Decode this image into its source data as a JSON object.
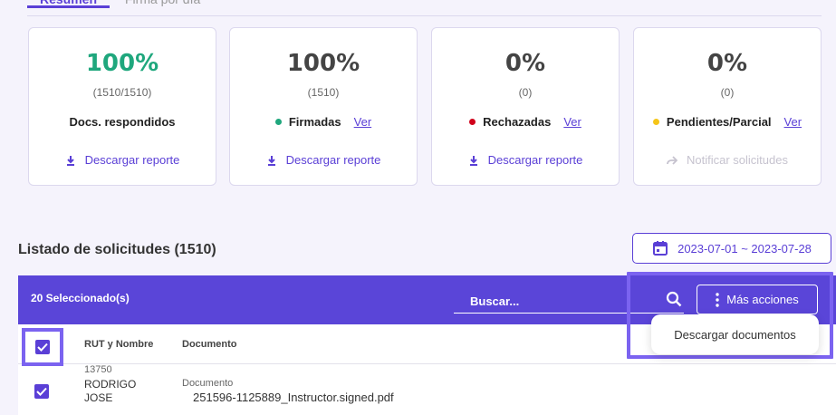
{
  "tabs": [
    {
      "label": "Resumen"
    },
    {
      "label": "Firma por día"
    }
  ],
  "cards": [
    {
      "percent": "100%",
      "count": "(1510/1510)",
      "label": "Docs. respondidos",
      "action": "Descargar reporte",
      "color": "#1fa77d"
    },
    {
      "percent": "100%",
      "count": "(1510)",
      "label": "Firmadas",
      "link": "Ver",
      "dot": "#1fa77d",
      "action": "Descargar reporte"
    },
    {
      "percent": "0%",
      "count": "(0)",
      "label": "Rechazadas",
      "link": "Ver",
      "dot": "#d0021b",
      "action": "Descargar reporte"
    },
    {
      "percent": "0%",
      "count": "(0)",
      "label": "Pendientes/Parcial",
      "link": "Ver",
      "dot": "#f5c518",
      "action": "Notificar solicitudes"
    }
  ],
  "list": {
    "title": "Listado de solicitudes (1510)",
    "date_range": "2023-07-01 ~ 2023-07-28"
  },
  "toolbar": {
    "selected": "20 Seleccionado(s)",
    "search_placeholder": "Buscar...",
    "more_actions": "Más acciones"
  },
  "dropdown": {
    "items": [
      "Descargar documentos"
    ]
  },
  "table": {
    "columns": [
      "RUT y Nombre",
      "Documento"
    ],
    "rows": [
      {
        "rut": "13750",
        "name1": "RODRIGO",
        "name2": "JOSE",
        "doc_label": "Documento",
        "doc_name": "251596-1125889_Instructor.signed.pdf"
      }
    ]
  },
  "colors": {
    "accent": "#5a3fd6",
    "toolbar": "#5a45d8",
    "highlight": "#7b63f0"
  }
}
